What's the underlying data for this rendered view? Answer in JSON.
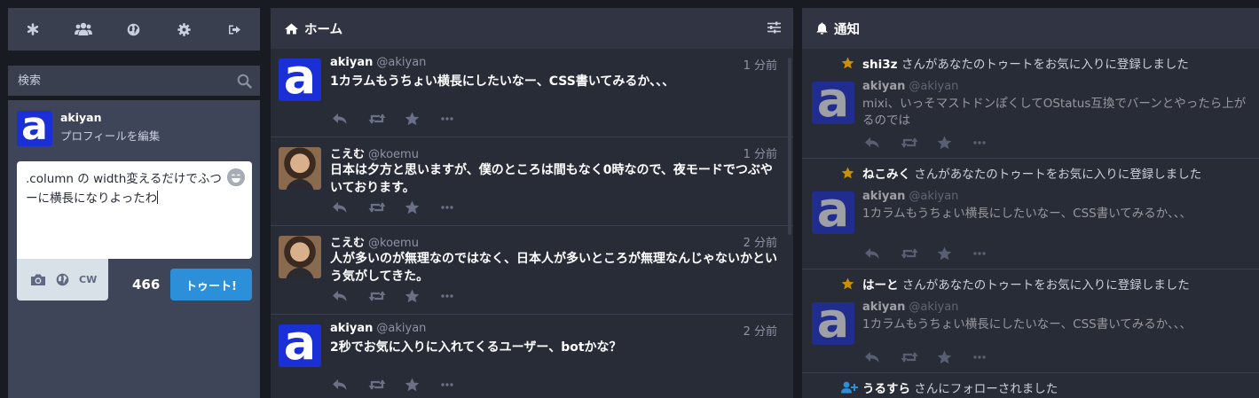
{
  "drawer": {
    "nav_icons": [
      "asterisk-icon",
      "people-icon",
      "globe-icon",
      "gear-icon",
      "sign-out-icon"
    ],
    "search_placeholder": "検索",
    "profile": {
      "display_name": "akiyan",
      "edit_link": "プロフィールを編集"
    },
    "compose": {
      "text_line1": ".column の width変えるだけでふつ",
      "text_line2": "ーに横長になりよったわ",
      "remaining": "466",
      "toot_label": "トゥート!",
      "cw_label": "CW"
    }
  },
  "home": {
    "title": "ホーム",
    "statuses": [
      {
        "display_name": "akiyan",
        "acct": "@akiyan",
        "time": "1 分前",
        "content": "1カラムもうちょい横長にしたいなー、CSS書いてみるか、、、",
        "avatar": "a"
      },
      {
        "display_name": "こえむ",
        "acct": "@koemu",
        "time": "1 分前",
        "content": "日本は夕方と思いますが、僕のところは間もなく0時なので、夜モードでつぶやいております。",
        "avatar": "photo"
      },
      {
        "display_name": "こえむ",
        "acct": "@koemu",
        "time": "2 分前",
        "content": "人が多いのが無理なのではなく、日本人が多いところが無理なんじゃないかという気がしてきた。",
        "avatar": "photo"
      },
      {
        "display_name": "akiyan",
        "acct": "@akiyan",
        "time": "2 分前",
        "content": "2秒でお気に入りに入れてくるユーザー、botかな？",
        "avatar": "a"
      }
    ]
  },
  "notifications": {
    "title": "通知",
    "items": [
      {
        "type": "favourite",
        "who": "shi3z",
        "message": " さんがあなたのトゥートをお気に入りに登録しました",
        "display_name": "akiyan",
        "acct": "@akiyan",
        "content": "mixi、いっそマストドンぽくしてOStatus互換でバーンとやったら上がるのでは"
      },
      {
        "type": "favourite",
        "who": "ねこみく",
        "message": " さんがあなたのトゥートをお気に入りに登録しました",
        "display_name": "akiyan",
        "acct": "@akiyan",
        "content": "1カラムもうちょい横長にしたいなー、CSS書いてみるか、、、"
      },
      {
        "type": "favourite",
        "who": "はーと",
        "message": " さんがあなたのトゥートをお気に入りに登録しました",
        "display_name": "akiyan",
        "acct": "@akiyan",
        "content": "1カラムもうちょい横長にしたいなー、CSS書いてみるか、、、"
      },
      {
        "type": "follow",
        "who": "うるすら",
        "message": " さんにフォローされました"
      }
    ]
  },
  "colors": {
    "accent": "#2b90d9",
    "star": "#ca8f04",
    "background": "#191b22",
    "column": "#282c37"
  }
}
